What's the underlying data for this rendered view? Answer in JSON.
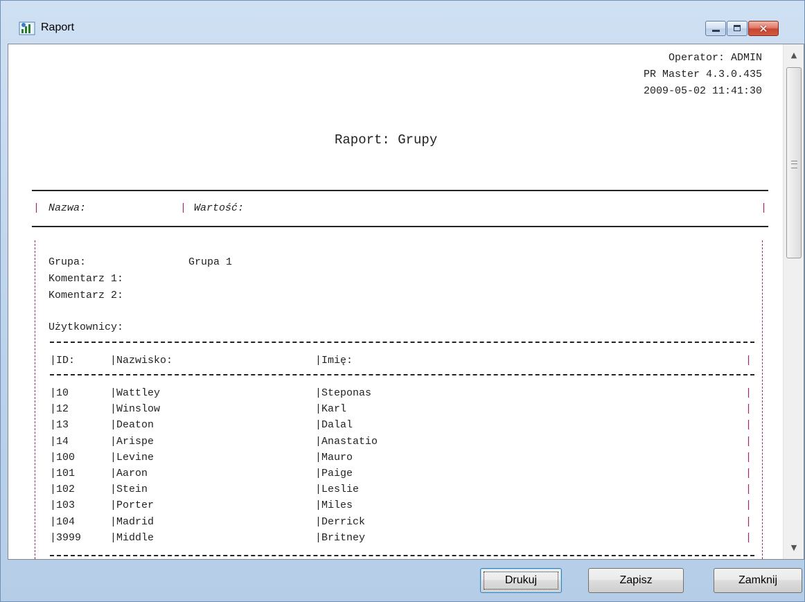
{
  "window": {
    "title": "Raport",
    "controls": {
      "close_glyph": "✕"
    }
  },
  "report": {
    "header": {
      "operator": "Operator: ADMIN",
      "version": "PR Master 4.3.0.435",
      "datetime": "2009-05-02 11:41:30"
    },
    "title": "Raport: Grupy",
    "columns": {
      "name": "Nazwa:",
      "value": "Wartość:"
    },
    "group": {
      "label": "Grupa:",
      "value": "Grupa 1",
      "comment1_label": "Komentarz 1:",
      "comment2_label": "Komentarz 2:",
      "users_label": "Użytkownicy:"
    },
    "users_table": {
      "headers": {
        "id": "ID:",
        "surname": "Nazwisko:",
        "firstname": "Imię:"
      },
      "rows": [
        {
          "id": "10",
          "surname": "Wattley",
          "firstname": "Steponas"
        },
        {
          "id": "12",
          "surname": "Winslow",
          "firstname": "Karl"
        },
        {
          "id": "13",
          "surname": "Deaton",
          "firstname": "Dalal"
        },
        {
          "id": "14",
          "surname": "Arispe",
          "firstname": "Anastatio"
        },
        {
          "id": "100",
          "surname": "Levine",
          "firstname": "Mauro"
        },
        {
          "id": "101",
          "surname": "Aaron",
          "firstname": "Paige"
        },
        {
          "id": "102",
          "surname": "Stein",
          "firstname": "Leslie"
        },
        {
          "id": "103",
          "surname": "Porter",
          "firstname": "Miles"
        },
        {
          "id": "104",
          "surname": "Madrid",
          "firstname": "Derrick"
        },
        {
          "id": "3999",
          "surname": "Middle",
          "firstname": "Britney"
        }
      ]
    }
  },
  "buttons": {
    "print": "Drukuj",
    "save": "Zapisz",
    "close": "Zamknij"
  },
  "colors": {
    "titlebar": "#bcd2ec",
    "accent_pipe": "#9a2a6a",
    "close_button": "#c8452f"
  }
}
